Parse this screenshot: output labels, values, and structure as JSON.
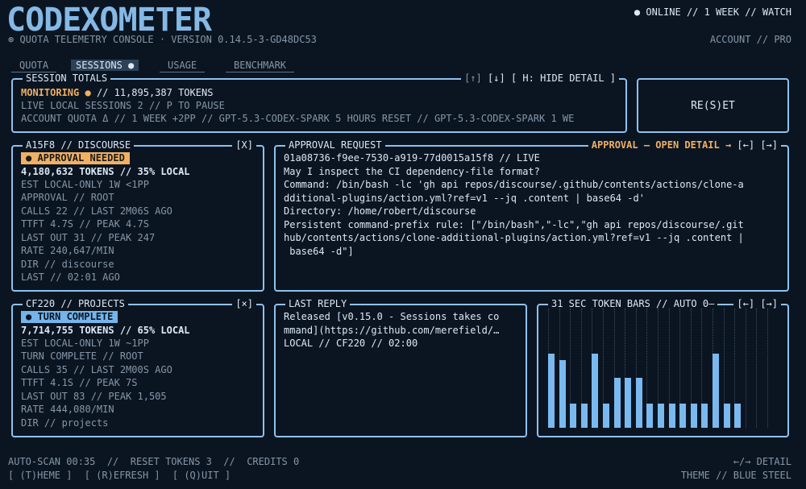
{
  "app": {
    "logo_text": "CODEXOMETER",
    "subtitle": "⊛ QUOTA TELEMETRY CONSOLE · VERSION 0.14.5-3-GD48DC53",
    "status": "● ONLINE // 1 WEEK // WATCH",
    "account": "ACCOUNT // PRO"
  },
  "tabs": [
    {
      "label": "QUOTA",
      "active": false
    },
    {
      "label": "SESSIONS ●",
      "active": true
    },
    {
      "label": "USAGE",
      "active": false
    },
    {
      "label": "BENCHMARK",
      "active": false
    }
  ],
  "session_totals": {
    "title": "SESSION TOTALS",
    "controls": {
      "up": "[↑]",
      "down": "[↓]",
      "hide": "[ H: HIDE DETAIL ]"
    },
    "monitoring": "MONITORING ●",
    "tokens": "//  11,895,387 TOKENS",
    "line2": "LIVE LOCAL SESSIONS 2 // P TO PAUSE",
    "line3": "ACCOUNT QUOTA Δ // 1 WEEK +2PP // GPT-5.3-CODEX-SPARK 5 HOURS RESET // GPT-5.3-CODEX-SPARK 1 WE"
  },
  "reset_button": "RE(S)ET",
  "session_a": {
    "title": "A15F8 // DISCOURSE",
    "close": "[X]",
    "badge": "● APPROVAL NEEDED",
    "tokens": "4,180,632 TOKENS // 35% LOCAL",
    "lines": [
      "EST LOCAL-ONLY 1W <1PP",
      "APPROVAL // ROOT",
      "CALLS 22 // LAST 2M06S AGO",
      "TTFT 4.7S // PEAK 4.7S",
      "LAST OUT 31 // PEAK 247",
      "RATE 240,647/MIN",
      "DIR // discourse",
      "LAST // 02:01 AGO"
    ]
  },
  "session_b": {
    "title": "CF220 // PROJECTS",
    "close": "[×]",
    "badge": "● TURN COMPLETE",
    "tokens": "7,714,755 TOKENS // 65% LOCAL",
    "lines": [
      "EST LOCAL-ONLY 1W ~1PP",
      "TURN COMPLETE // ROOT",
      "CALLS 35 // LAST 2M00S AGO",
      "TTFT 4.1S // PEAK 7S",
      "LAST OUT 83 // PEAK 1,505",
      "RATE 444,080/MIN",
      "DIR // projects"
    ]
  },
  "approval": {
    "title": "APPROVAL REQUEST",
    "open_detail": "APPROVAL – OPEN DETAIL →",
    "nav": "[←] [→]",
    "lines": [
      "01a08736-f9ee-7530-a919-77d0015a15f8 // LIVE",
      "May I inspect the CI dependency-file format?",
      "Command: /bin/bash -lc 'gh api repos/discourse/.github/contents/actions/clone-a",
      "dditional-plugins/action.yml?ref=v1 --jq .content | base64 -d'",
      "Directory: /home/robert/discourse",
      "Persistent command-prefix rule: [\"/bin/bash\",\"-lc\",\"gh api repos/discourse/.git",
      "hub/contents/actions/clone-additional-plugins/action.yml?ref=v1 --jq .content |",
      " base64 -d\"]"
    ]
  },
  "last_reply": {
    "title": "LAST REPLY",
    "lines": [
      "Released [v0.15.0 - Sessions takes co",
      "mmand](https://github.com/merefield/…",
      "LOCAL // CF220 // 02:00"
    ]
  },
  "token_bars": {
    "title": "31 SEC TOKEN BARS // AUTO 0–",
    "nav": "[←] [→]",
    "values": [
      0.62,
      0.57,
      0.2,
      0.2,
      0.62,
      0.2,
      0.42,
      0.42,
      0.42,
      0.2,
      0.2,
      0.2,
      0.2,
      0.2,
      0.2,
      0.62,
      0.2,
      0.2,
      0.0,
      0.0,
      0.0
    ]
  },
  "footer": {
    "line1": "AUTO-SCAN 00:35  //  RESET TOKENS 3  //  CREDITS 0",
    "theme": "[ (T)HEME ]",
    "refresh": "[ (R)EFRESH ]",
    "quit": "[ (Q)UIT ]",
    "detail": "←/→ DETAIL",
    "theme_name": "THEME // BLUE STEEL"
  }
}
